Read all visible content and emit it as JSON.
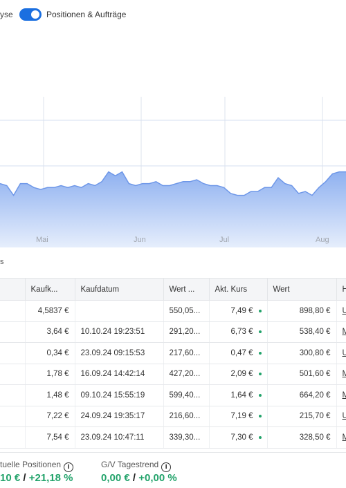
{
  "topbar": {
    "left_fragment": "yse",
    "toggle_label": "Positionen & Aufträge",
    "toggle_on": true
  },
  "colors": {
    "accent": "#1b6fe0",
    "area_fill": "#a9c3f3",
    "area_line": "#6e97e8",
    "positive": "#23a36b"
  },
  "chart_data": {
    "type": "area",
    "x_labels": [
      "Mai",
      "Jun",
      "Jul",
      "Aug"
    ],
    "values": [
      52,
      51,
      46,
      52,
      52,
      50,
      49,
      50,
      50,
      51,
      50,
      51,
      50,
      52,
      51,
      53,
      58,
      56,
      58,
      52,
      51,
      52,
      52,
      53,
      51,
      51,
      52,
      53,
      53,
      54,
      52,
      51,
      51,
      50,
      47,
      46,
      46,
      48,
      48,
      50,
      50,
      55,
      52,
      51,
      47,
      48,
      46,
      50,
      53,
      57,
      58,
      58
    ],
    "ylim": [
      0,
      100
    ]
  },
  "section_fragment": "s",
  "table": {
    "headers": [
      "",
      "Kaufk...",
      "Kaufdatum",
      "Wert ...",
      "Akt. Kurs",
      "Wert",
      "H..."
    ],
    "rows": [
      {
        "kaufkurs": "4,5837 €",
        "kaufdatum": "",
        "wert1": "550,05...",
        "kurs": "7,49 €",
        "wert2": "898,80 €",
        "h": "U"
      },
      {
        "kaufkurs": "3,64 €",
        "kaufdatum": "10.10.24 19:23:51",
        "wert1": "291,20...",
        "kurs": "6,73 €",
        "wert2": "538,40 €",
        "h": "M"
      },
      {
        "kaufkurs": "0,34 €",
        "kaufdatum": "23.09.24 09:15:53",
        "wert1": "217,60...",
        "kurs": "0,47 €",
        "wert2": "300,80 €",
        "h": "U"
      },
      {
        "kaufkurs": "1,78 €",
        "kaufdatum": "16.09.24 14:42:14",
        "wert1": "427,20...",
        "kurs": "2,09 €",
        "wert2": "501,60 €",
        "h": "M"
      },
      {
        "kaufkurs": "1,48 €",
        "kaufdatum": "09.10.24 15:55:19",
        "wert1": "599,40...",
        "kurs": "1,64 €",
        "wert2": "664,20 €",
        "h": "M"
      },
      {
        "kaufkurs": "7,22 €",
        "kaufdatum": "24.09.24 19:35:17",
        "wert1": "216,60...",
        "kurs": "7,19 €",
        "wert2": "215,70 €",
        "h": "U"
      },
      {
        "kaufkurs": "7,54 €",
        "kaufdatum": "23.09.24 10:47:11",
        "wert1": "339,30...",
        "kurs": "7,30 €",
        "wert2": "328,50 €",
        "h": "M"
      }
    ]
  },
  "footer": {
    "positions_label": "tuelle Positionen",
    "positions_value_abs": "10 €",
    "positions_sep": "/",
    "positions_value_pct": "+21,18 %",
    "daytrend_label": "G/V Tagestrend",
    "daytrend_value_abs": "0,00 €",
    "daytrend_sep": "/",
    "daytrend_value_pct": "+0,00 %"
  }
}
